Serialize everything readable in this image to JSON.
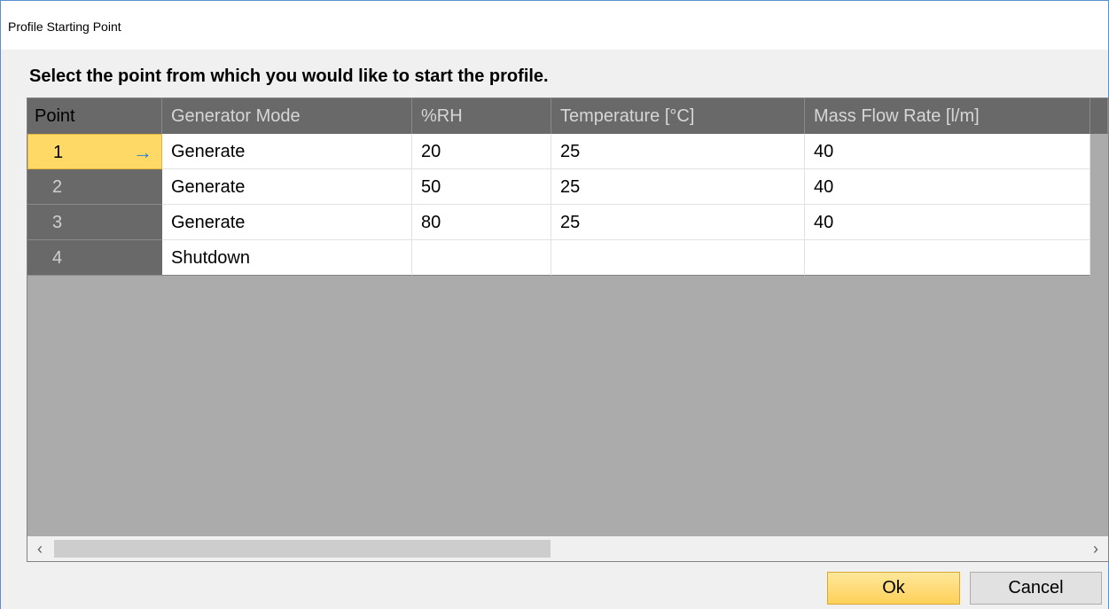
{
  "window": {
    "title": "Profile Starting Point"
  },
  "instruction": "Select the point from which you would like to start the profile.",
  "table": {
    "columns": [
      "Point",
      "Generator Mode",
      "%RH",
      "Temperature [°C]",
      "Mass Flow Rate [l/m]"
    ],
    "rows": [
      {
        "point": "1",
        "mode": "Generate",
        "rh": "20",
        "temp": "25",
        "flow": "40",
        "selected": true
      },
      {
        "point": "2",
        "mode": "Generate",
        "rh": "50",
        "temp": "25",
        "flow": "40"
      },
      {
        "point": "3",
        "mode": "Generate",
        "rh": "80",
        "temp": "25",
        "flow": "40"
      },
      {
        "point": "4",
        "mode": "Shutdown",
        "rh": "",
        "temp": "",
        "flow": ""
      }
    ]
  },
  "scrollbar": {
    "left_icon": "chevron-left-icon",
    "right_icon": "chevron-right-icon"
  },
  "buttons": {
    "ok": "Ok",
    "cancel": "Cancel"
  },
  "colors": {
    "selected_row": "#ffd965",
    "ok_button": "#fdd15a",
    "window_border": "#5a8fd0"
  }
}
